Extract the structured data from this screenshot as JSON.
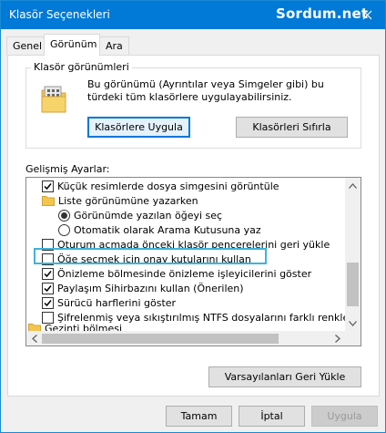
{
  "window": {
    "title": "Klasör Seçenekleri",
    "watermark": "Sordum.net"
  },
  "tabs": [
    {
      "label": "Genel"
    },
    {
      "label": "Görünüm"
    },
    {
      "label": "Ara"
    }
  ],
  "folder_views": {
    "group_label": "Klasör görünümleri",
    "description": "Bu görünümü (Ayrıntılar veya Simgeler gibi) bu türdeki tüm klasörlere uygulayabilirsiniz.",
    "apply_button": "Klasörlere Uygula",
    "reset_button": "Klasörleri Sıfırla"
  },
  "advanced": {
    "label": "Gelişmiş Ayarlar:",
    "items": [
      {
        "type": "checkbox",
        "text": "Küçük resimlerde dosya simgesini görüntüle",
        "checked": true
      },
      {
        "type": "folder",
        "text": "Liste görünümüne yazarken"
      },
      {
        "type": "radio",
        "text": "Görünümde yazılan öğeyi seç",
        "checked": true
      },
      {
        "type": "radio",
        "text": "Otomatik olarak Arama Kutusuna yaz",
        "checked": false
      },
      {
        "type": "checkbox",
        "text": "Oturum açmada önceki klasör pencerelerini geri yükle",
        "checked": false
      },
      {
        "type": "checkbox",
        "text": "Öğe seçmek için onay kutularını kullan",
        "checked": false
      },
      {
        "type": "checkbox",
        "text": "Önizleme bölmesinde önizleme işleyicilerini göster",
        "checked": true
      },
      {
        "type": "checkbox",
        "text": "Paylaşım Sihirbazını kullan (Önerilen)",
        "checked": true
      },
      {
        "type": "checkbox",
        "text": "Sürücü harflerini göster",
        "checked": true
      },
      {
        "type": "checkbox",
        "text": "Şifrelenmiş veya sıkıştırılmış NTFS dosyalarını farklı renkle görüntüle",
        "checked": false
      },
      {
        "type": "folder",
        "text": "Gezinti bölmesi"
      }
    ],
    "restore_button": "Varsayılanları Geri Yükle"
  },
  "footer": {
    "ok": "Tamam",
    "cancel": "İptal",
    "apply": "Uygula"
  },
  "colors": {
    "titlebar": "#0079d7",
    "highlight": "#3fb4d6",
    "default_button_border": "#0078d7"
  }
}
